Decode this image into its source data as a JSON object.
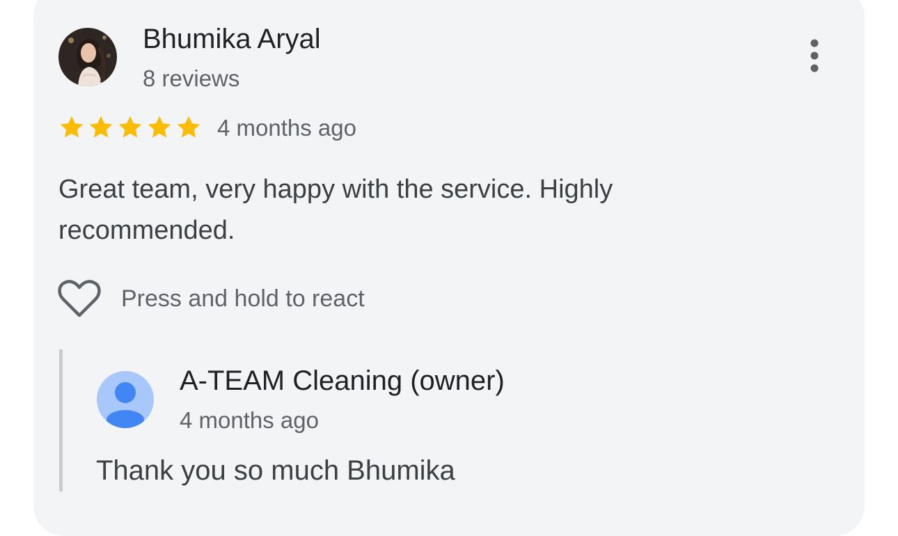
{
  "review": {
    "reviewer_name": "Bhumika Aryal",
    "review_count": "8 reviews",
    "rating": 5,
    "rating_max": 5,
    "time": "4 months ago",
    "text": "Great team, very happy with the service. Highly recommended.",
    "react_label": "Press and hold to react",
    "menu_icon": "more-vert-icon",
    "react_icon": "heart-outline-icon"
  },
  "reply": {
    "owner_name": "A-TEAM Cleaning (owner)",
    "time": "4 months ago",
    "text": "Thank you so much Bhumika",
    "avatar_icon": "default-person-avatar-icon"
  },
  "colors": {
    "card_background": "#f3f4f6",
    "star": "#fbbc04",
    "owner_avatar_bg": "#a8c7fa",
    "owner_avatar_fg": "#4285f4",
    "reply_bar": "#c9cbcf"
  }
}
